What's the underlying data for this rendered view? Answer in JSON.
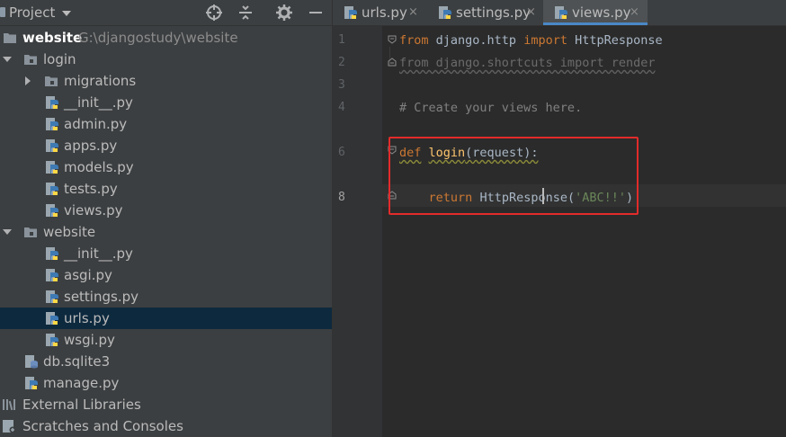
{
  "project_panel": {
    "title": "Project",
    "tree": [
      {
        "label": "website",
        "path": "G:\\djangostudy\\website",
        "type": "root"
      },
      {
        "label": "login",
        "type": "folder"
      },
      {
        "label": "migrations",
        "type": "folder"
      },
      {
        "label": "__init__.py",
        "type": "python"
      },
      {
        "label": "admin.py",
        "type": "python"
      },
      {
        "label": "apps.py",
        "type": "python"
      },
      {
        "label": "models.py",
        "type": "python"
      },
      {
        "label": "tests.py",
        "type": "python"
      },
      {
        "label": "views.py",
        "type": "python"
      },
      {
        "label": "website",
        "type": "folder"
      },
      {
        "label": "__init__.py",
        "type": "python"
      },
      {
        "label": "asgi.py",
        "type": "python"
      },
      {
        "label": "settings.py",
        "type": "python"
      },
      {
        "label": "urls.py",
        "type": "python",
        "selected": true
      },
      {
        "label": "wsgi.py",
        "type": "python"
      },
      {
        "label": "db.sqlite3",
        "type": "database"
      },
      {
        "label": "manage.py",
        "type": "python"
      },
      {
        "label": "External Libraries",
        "type": "libraries"
      },
      {
        "label": "Scratches and Consoles",
        "type": "scratches"
      }
    ]
  },
  "tabs": [
    {
      "label": "urls.py",
      "close": "×",
      "active": false
    },
    {
      "label": "settings.py",
      "close": "×",
      "active": false
    },
    {
      "label": "views.py",
      "close": "×",
      "active": true
    }
  ],
  "editor": {
    "line_numbers": [
      "1",
      "2",
      "3",
      "4",
      "6",
      "8"
    ],
    "code": {
      "l1_kw1": "from",
      "l1_mod": " django.http ",
      "l1_kw2": "import",
      "l1_name": " HttpResponse",
      "l2": "from django.shortcuts import render",
      "l4": "# Create your views here.",
      "l6_kw": "def",
      "l6_fn": "login",
      "l6_params": "(request):",
      "l8_kw": "return",
      "l8_call": "HttpResponse",
      "l8_open": "(",
      "l8_str": "'ABC!!'",
      "l8_close": ")"
    }
  },
  "colors": {
    "keyword": "#cc7832",
    "string": "#6a8759",
    "comment": "#808080",
    "function": "#ffc66d",
    "highlight_box": "#e22b2b",
    "selection": "#0d293e",
    "active_tab_underline": "#4a88c7"
  },
  "icons": [
    "project-icon",
    "crosshair-icon",
    "collapse-icon",
    "gear-icon",
    "minimize-icon",
    "python-file-icon",
    "folder-icon",
    "database-icon",
    "libraries-icon",
    "scratches-icon",
    "fold-icon"
  ]
}
